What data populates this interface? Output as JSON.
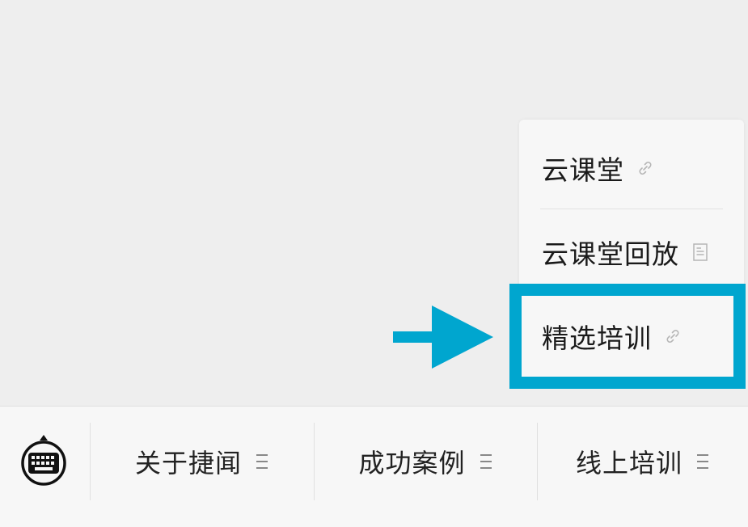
{
  "submenu": {
    "items": [
      {
        "label": "云课堂",
        "icon": "link-icon"
      },
      {
        "label": "云课堂回放",
        "icon": "document-icon"
      },
      {
        "label": "精选培训",
        "icon": "link-icon"
      }
    ]
  },
  "highlight": {
    "color": "#00a6cf",
    "target": "精选培训"
  },
  "bottom_bar": {
    "keyboard_icon": "keyboard-icon",
    "tabs": [
      {
        "label": "关于捷闻",
        "icon": "menu-icon"
      },
      {
        "label": "成功案例",
        "icon": "menu-icon"
      },
      {
        "label": "线上培训",
        "icon": "menu-icon"
      }
    ]
  },
  "colors": {
    "background": "#eeeeee",
    "panel": "#f7f7f7",
    "accent": "#00a6cf"
  }
}
